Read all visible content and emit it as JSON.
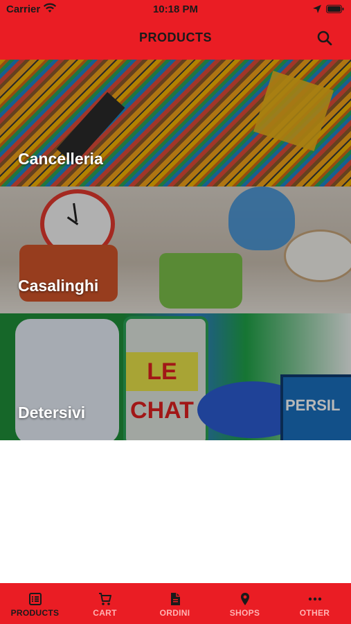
{
  "status_bar": {
    "carrier": "Carrier",
    "time": "10:18 PM",
    "icons": [
      "wifi-icon",
      "location-arrow-icon",
      "battery-icon"
    ]
  },
  "header": {
    "title": "PRODUCTS",
    "search_icon": "search-icon",
    "background_color": "#ea1d24"
  },
  "categories": [
    {
      "label": "Cancelleria"
    },
    {
      "label": "Casalinghi"
    },
    {
      "label": "Detersivi"
    }
  ],
  "detersivi_brands": {
    "le_chat": "LE CHAT",
    "persil": "PERSIL"
  },
  "tabbar": {
    "active_index": 0,
    "tabs": [
      {
        "label": "PRODUCTS",
        "icon": "list-icon"
      },
      {
        "label": "CART",
        "icon": "cart-icon"
      },
      {
        "label": "ORDINI",
        "icon": "document-icon"
      },
      {
        "label": "SHOPS",
        "icon": "map-pin-icon"
      },
      {
        "label": "OTHER",
        "icon": "more-icon"
      }
    ]
  }
}
